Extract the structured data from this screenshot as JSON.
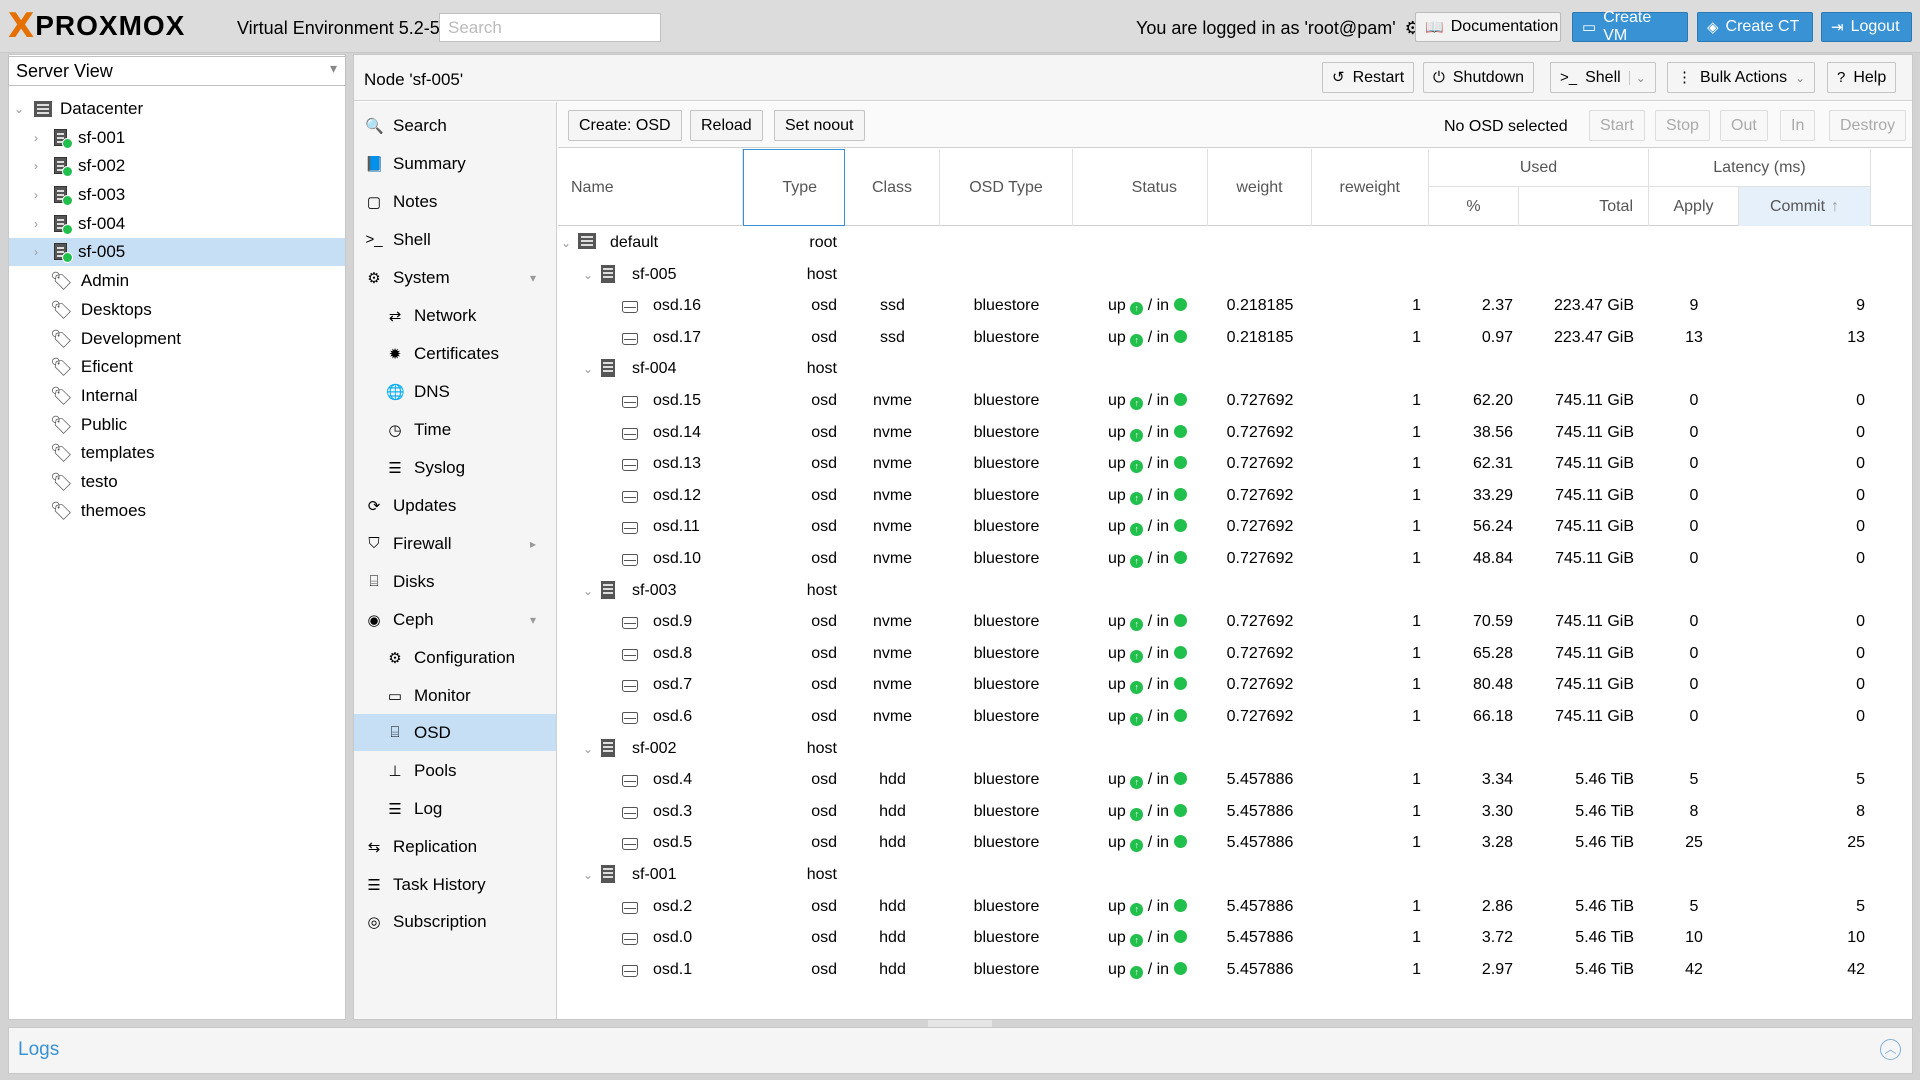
{
  "header": {
    "logo_x": "X",
    "logo_text": "PROXMOX",
    "version": "Virtual Environment 5.2-5",
    "search_placeholder": "Search",
    "logged_in": "You are logged in as 'root@pam'",
    "buttons": {
      "documentation": "Documentation",
      "create_vm": "Create VM",
      "create_ct": "Create CT",
      "logout": "Logout"
    }
  },
  "tree": {
    "view": "Server View",
    "datacenter": "Datacenter",
    "nodes": [
      "sf-001",
      "sf-002",
      "sf-003",
      "sf-004",
      "sf-005"
    ],
    "pools": [
      "Admin",
      "Desktops",
      "Development",
      "Eficent",
      "Internal",
      "Public",
      "templates",
      "testo",
      "themoes"
    ]
  },
  "content": {
    "title": "Node 'sf-005'",
    "buttons": {
      "restart": "Restart",
      "shutdown": "Shutdown",
      "shell": "Shell",
      "bulk": "Bulk Actions",
      "help": "Help"
    }
  },
  "menu": {
    "search": "Search",
    "summary": "Summary",
    "notes": "Notes",
    "shell": "Shell",
    "system": "System",
    "network": "Network",
    "certificates": "Certificates",
    "dns": "DNS",
    "time": "Time",
    "syslog": "Syslog",
    "updates": "Updates",
    "firewall": "Firewall",
    "disks": "Disks",
    "ceph": "Ceph",
    "configuration": "Configuration",
    "monitor": "Monitor",
    "osd": "OSD",
    "pools": "Pools",
    "log": "Log",
    "replication": "Replication",
    "task_history": "Task History",
    "subscription": "Subscription"
  },
  "osd_toolbar": {
    "create": "Create: OSD",
    "reload": "Reload",
    "set_noout": "Set noout",
    "status": "No OSD selected",
    "start": "Start",
    "stop": "Stop",
    "out": "Out",
    "in": "In",
    "destroy": "Destroy"
  },
  "columns": {
    "name": "Name",
    "type": "Type",
    "class": "Class",
    "osd_type": "OSD Type",
    "status": "Status",
    "weight": "weight",
    "reweight": "reweight",
    "used": "Used",
    "used_pct": "%",
    "used_total": "Total",
    "latency": "Latency (ms)",
    "apply": "Apply",
    "commit": "Commit"
  },
  "status_text": {
    "up": "up",
    "sep": "/ in"
  },
  "rows": [
    {
      "kind": "root",
      "name": "default",
      "type": "root"
    },
    {
      "kind": "host",
      "name": "sf-005",
      "type": "host"
    },
    {
      "kind": "osd",
      "name": "osd.16",
      "type": "osd",
      "class": "ssd",
      "osdtype": "bluestore",
      "weight": "0.218185",
      "reweight": "1",
      "pct": "2.37",
      "total": "223.47 GiB",
      "apply": "9",
      "commit": "9"
    },
    {
      "kind": "osd",
      "name": "osd.17",
      "type": "osd",
      "class": "ssd",
      "osdtype": "bluestore",
      "weight": "0.218185",
      "reweight": "1",
      "pct": "0.97",
      "total": "223.47 GiB",
      "apply": "13",
      "commit": "13"
    },
    {
      "kind": "host",
      "name": "sf-004",
      "type": "host"
    },
    {
      "kind": "osd",
      "name": "osd.15",
      "type": "osd",
      "class": "nvme",
      "osdtype": "bluestore",
      "weight": "0.727692",
      "reweight": "1",
      "pct": "62.20",
      "total": "745.11 GiB",
      "apply": "0",
      "commit": "0"
    },
    {
      "kind": "osd",
      "name": "osd.14",
      "type": "osd",
      "class": "nvme",
      "osdtype": "bluestore",
      "weight": "0.727692",
      "reweight": "1",
      "pct": "38.56",
      "total": "745.11 GiB",
      "apply": "0",
      "commit": "0"
    },
    {
      "kind": "osd",
      "name": "osd.13",
      "type": "osd",
      "class": "nvme",
      "osdtype": "bluestore",
      "weight": "0.727692",
      "reweight": "1",
      "pct": "62.31",
      "total": "745.11 GiB",
      "apply": "0",
      "commit": "0"
    },
    {
      "kind": "osd",
      "name": "osd.12",
      "type": "osd",
      "class": "nvme",
      "osdtype": "bluestore",
      "weight": "0.727692",
      "reweight": "1",
      "pct": "33.29",
      "total": "745.11 GiB",
      "apply": "0",
      "commit": "0"
    },
    {
      "kind": "osd",
      "name": "osd.11",
      "type": "osd",
      "class": "nvme",
      "osdtype": "bluestore",
      "weight": "0.727692",
      "reweight": "1",
      "pct": "56.24",
      "total": "745.11 GiB",
      "apply": "0",
      "commit": "0"
    },
    {
      "kind": "osd",
      "name": "osd.10",
      "type": "osd",
      "class": "nvme",
      "osdtype": "bluestore",
      "weight": "0.727692",
      "reweight": "1",
      "pct": "48.84",
      "total": "745.11 GiB",
      "apply": "0",
      "commit": "0"
    },
    {
      "kind": "host",
      "name": "sf-003",
      "type": "host"
    },
    {
      "kind": "osd",
      "name": "osd.9",
      "type": "osd",
      "class": "nvme",
      "osdtype": "bluestore",
      "weight": "0.727692",
      "reweight": "1",
      "pct": "70.59",
      "total": "745.11 GiB",
      "apply": "0",
      "commit": "0"
    },
    {
      "kind": "osd",
      "name": "osd.8",
      "type": "osd",
      "class": "nvme",
      "osdtype": "bluestore",
      "weight": "0.727692",
      "reweight": "1",
      "pct": "65.28",
      "total": "745.11 GiB",
      "apply": "0",
      "commit": "0"
    },
    {
      "kind": "osd",
      "name": "osd.7",
      "type": "osd",
      "class": "nvme",
      "osdtype": "bluestore",
      "weight": "0.727692",
      "reweight": "1",
      "pct": "80.48",
      "total": "745.11 GiB",
      "apply": "0",
      "commit": "0"
    },
    {
      "kind": "osd",
      "name": "osd.6",
      "type": "osd",
      "class": "nvme",
      "osdtype": "bluestore",
      "weight": "0.727692",
      "reweight": "1",
      "pct": "66.18",
      "total": "745.11 GiB",
      "apply": "0",
      "commit": "0"
    },
    {
      "kind": "host",
      "name": "sf-002",
      "type": "host"
    },
    {
      "kind": "osd",
      "name": "osd.4",
      "type": "osd",
      "class": "hdd",
      "osdtype": "bluestore",
      "weight": "5.457886",
      "reweight": "1",
      "pct": "3.34",
      "total": "5.46 TiB",
      "apply": "5",
      "commit": "5"
    },
    {
      "kind": "osd",
      "name": "osd.3",
      "type": "osd",
      "class": "hdd",
      "osdtype": "bluestore",
      "weight": "5.457886",
      "reweight": "1",
      "pct": "3.30",
      "total": "5.46 TiB",
      "apply": "8",
      "commit": "8"
    },
    {
      "kind": "osd",
      "name": "osd.5",
      "type": "osd",
      "class": "hdd",
      "osdtype": "bluestore",
      "weight": "5.457886",
      "reweight": "1",
      "pct": "3.28",
      "total": "5.46 TiB",
      "apply": "25",
      "commit": "25"
    },
    {
      "kind": "host",
      "name": "sf-001",
      "type": "host"
    },
    {
      "kind": "osd",
      "name": "osd.2",
      "type": "osd",
      "class": "hdd",
      "osdtype": "bluestore",
      "weight": "5.457886",
      "reweight": "1",
      "pct": "2.86",
      "total": "5.46 TiB",
      "apply": "5",
      "commit": "5"
    },
    {
      "kind": "osd",
      "name": "osd.0",
      "type": "osd",
      "class": "hdd",
      "osdtype": "bluestore",
      "weight": "5.457886",
      "reweight": "1",
      "pct": "3.72",
      "total": "5.46 TiB",
      "apply": "10",
      "commit": "10"
    },
    {
      "kind": "osd",
      "name": "osd.1",
      "type": "osd",
      "class": "hdd",
      "osdtype": "bluestore",
      "weight": "5.457886",
      "reweight": "1",
      "pct": "2.97",
      "total": "5.46 TiB",
      "apply": "42",
      "commit": "42"
    }
  ],
  "footer": {
    "logs": "Logs"
  },
  "colors": {
    "accent": "#3892d4",
    "brand": "#e57000",
    "ok": "#21bf4b",
    "selection": "#c6dff5"
  }
}
